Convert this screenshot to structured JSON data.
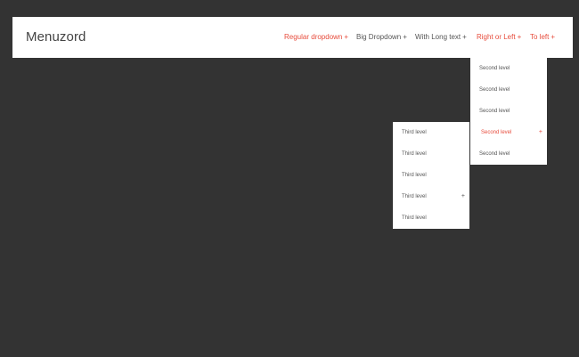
{
  "navbar": {
    "logo": "Menuzord",
    "items": [
      {
        "label": "Regular dropdown",
        "plus": "+",
        "accent": "#e74c3c"
      },
      {
        "label": "Big Dropdown",
        "plus": "+"
      },
      {
        "label": "With Long text",
        "plus": "+"
      },
      {
        "label": "Right or Left",
        "plus": "+",
        "accent": "#e74c3c"
      },
      {
        "label": "To left",
        "plus": "+",
        "accent": "#e74c3c"
      }
    ]
  },
  "second_level": [
    {
      "label": "Second level"
    },
    {
      "label": "Second level"
    },
    {
      "label": "Second level"
    },
    {
      "label": "Second level",
      "plus": "+",
      "active": true
    },
    {
      "label": "Second level"
    }
  ],
  "third_level": [
    {
      "label": "Third level"
    },
    {
      "label": "Third level"
    },
    {
      "label": "Third level"
    },
    {
      "label": "Third level",
      "plus": "+"
    },
    {
      "label": "Third level"
    }
  ],
  "colors": {
    "background": "#333333",
    "accent": "#e74c3c",
    "text": "#555555",
    "panel": "#ffffff"
  }
}
